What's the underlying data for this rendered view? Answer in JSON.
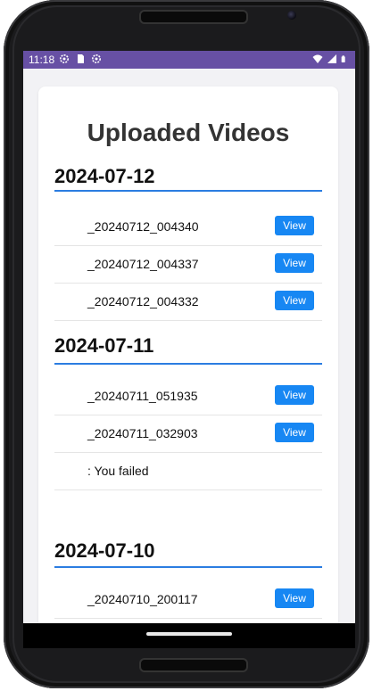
{
  "status_bar": {
    "time": "11:18",
    "left_icons": [
      "settings-gear-icon",
      "sd-card-icon",
      "settings-gear-icon"
    ],
    "right_icons": [
      "wifi-icon",
      "signal-icon",
      "battery-icon"
    ],
    "color": "#6750a4"
  },
  "page": {
    "title": "Uploaded Videos"
  },
  "sections": [
    {
      "date": "2024-07-12",
      "items": [
        {
          "label": "_20240712_004340",
          "action": "View"
        },
        {
          "label": "_20240712_004337",
          "action": "View"
        },
        {
          "label": "_20240712_004332",
          "action": "View"
        }
      ]
    },
    {
      "date": "2024-07-11",
      "items": [
        {
          "label": "_20240711_051935",
          "action": "View"
        },
        {
          "label": "_20240711_032903",
          "action": "View"
        },
        {
          "label": ": You failed",
          "action": ""
        }
      ]
    },
    {
      "date": "2024-07-10",
      "items": [
        {
          "label": "_20240710_200117",
          "action": "View"
        }
      ]
    }
  ],
  "colors": {
    "accent": "#1787f3",
    "divider": "#2b7de1"
  }
}
